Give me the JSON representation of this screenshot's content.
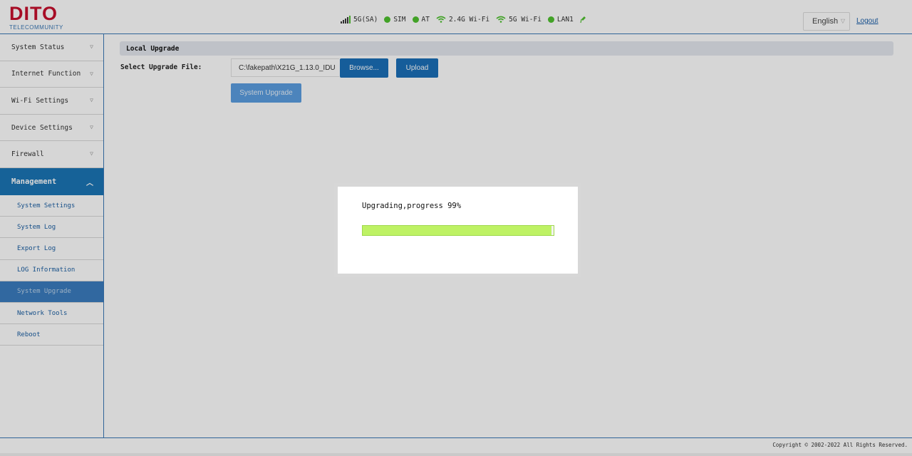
{
  "header": {
    "logo_text": "DITO",
    "logo_subtext": "TELECOMMUNITY",
    "status": [
      {
        "icon": "signal-strength-icon",
        "label": "5G(SA)"
      },
      {
        "icon": "status-dot-icon",
        "label": "SIM"
      },
      {
        "icon": "status-dot-icon",
        "label": "AT"
      },
      {
        "icon": "wifi-icon",
        "label": "2.4G Wi-Fi"
      },
      {
        "icon": "wifi-icon",
        "label": "5G Wi-Fi"
      },
      {
        "icon": "status-dot-icon",
        "label": "LAN1"
      },
      {
        "icon": "lan-plug-icon",
        "label": ""
      }
    ],
    "language": "English",
    "logout": "Logout"
  },
  "sidebar": {
    "items": [
      {
        "label": "System Status"
      },
      {
        "label": "Internet Function"
      },
      {
        "label": "Wi-Fi Settings"
      },
      {
        "label": "Device Settings"
      },
      {
        "label": "Firewall"
      }
    ],
    "active_section": "Management",
    "sub_items": [
      {
        "label": "System Settings"
      },
      {
        "label": "System Log"
      },
      {
        "label": "Export Log"
      },
      {
        "label": "LOG Information"
      },
      {
        "label": "System Upgrade"
      },
      {
        "label": "Network Tools"
      },
      {
        "label": "Reboot"
      }
    ]
  },
  "main": {
    "panel_title": "Local Upgrade",
    "field_label": "Select Upgrade File:",
    "file_value": "C:\\fakepath\\X21G_1.13.0_IDU",
    "browse_label": "Browse...",
    "upload_label": "Upload",
    "system_upgrade_label": "System Upgrade"
  },
  "dialog": {
    "text": "Upgrading,progress 99%",
    "progress_percent": 99
  },
  "footer": {
    "copyright": "Copyright © 2002-2022 All Rights Reserved."
  },
  "colors": {
    "brand_red": "#c8102e",
    "accent_blue": "#1b75b5",
    "status_green": "#4fc12f",
    "progress_green": "#bef264"
  }
}
